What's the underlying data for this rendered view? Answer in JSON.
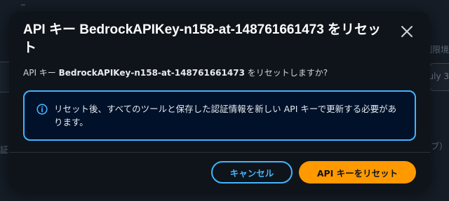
{
  "dialog": {
    "title": "API キー BedrockAPIKey-n158-at-148761661473 をリセット",
    "message_prefix": "API キー ",
    "message_key": "BedrockAPIKey-n158-at-148761661473",
    "message_suffix": " をリセットしますか?",
    "info_text": "リセット後、すべてのツールと保存した認証情報を新しい API キーで更新する必要があります。",
    "cancel_label": "キャンセル",
    "reset_label": "API キーをリセット"
  },
  "background": {
    "right_text_1": "制限境",
    "right_text_2": "uly 3",
    "left_text": "証",
    "right_text_3": "ブ）"
  },
  "colors": {
    "modal_bg": "#0f141a",
    "info_border": "#42b4ff",
    "primary_button": "#ff9900",
    "link_blue": "#42b4ff"
  }
}
